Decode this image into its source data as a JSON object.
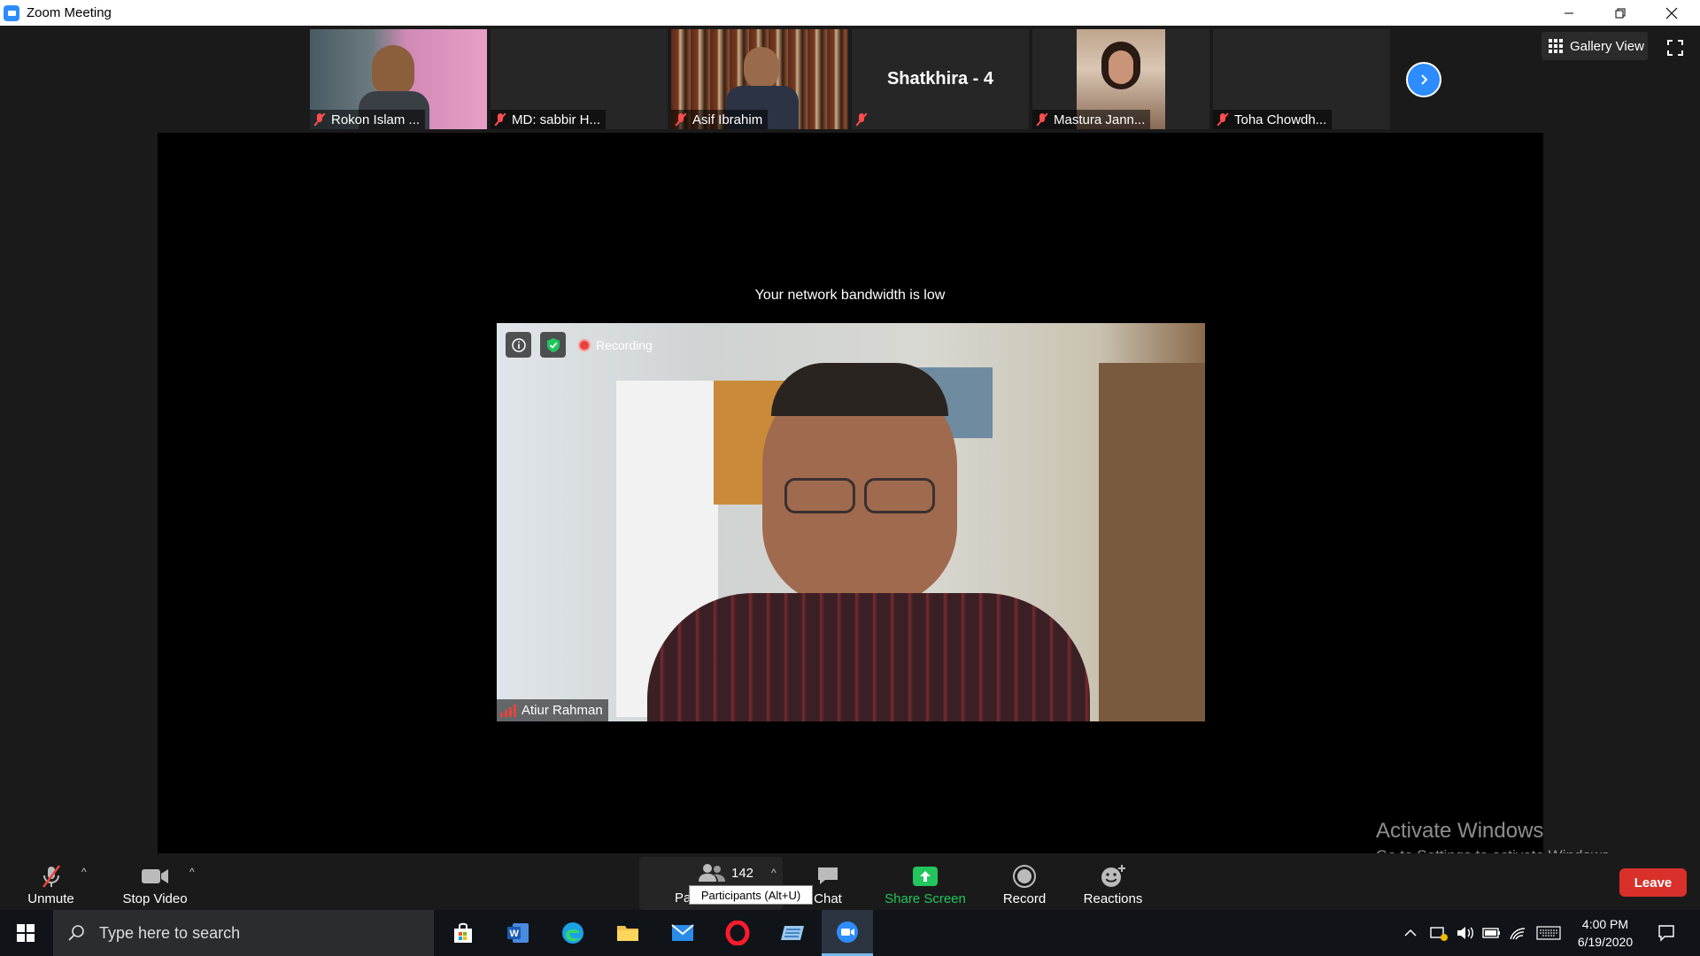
{
  "window": {
    "title": "Zoom Meeting"
  },
  "strip": {
    "tiles": [
      {
        "name": "Rokon Islam ..."
      },
      {
        "name": "MD: sabbir H..."
      },
      {
        "name": "Asif Ibrahim"
      },
      {
        "name": "",
        "title": "Shatkhira - 4"
      },
      {
        "name": "Mastura Jann..."
      },
      {
        "name": "Toha Chowdh..."
      }
    ],
    "gallery_view_label": "Gallery View"
  },
  "main": {
    "bandwidth_message": "Your network bandwidth is low",
    "recording_label": "Recording",
    "active_speaker": "Atiur Rahman"
  },
  "toolbar": {
    "unmute": "Unmute",
    "stop_video": "Stop Video",
    "participants_count": "142",
    "participants_label_visible": "Pa",
    "participants_tooltip": "Participants (Alt+U)",
    "chat": "Chat",
    "share_screen": "Share Screen",
    "record": "Record",
    "reactions": "Reactions",
    "leave": "Leave"
  },
  "watermark": {
    "line1": "Activate Windows",
    "line2": "Go to Settings to activate Windows."
  },
  "taskbar": {
    "search_placeholder": "Type here to search",
    "time": "4:00 PM",
    "date": "6/19/2020"
  },
  "colors": {
    "zoom_blue": "#2D8CFF",
    "leave_red": "#D9302C",
    "share_green": "#22C55E",
    "mute_red": "#FF4D4D"
  }
}
